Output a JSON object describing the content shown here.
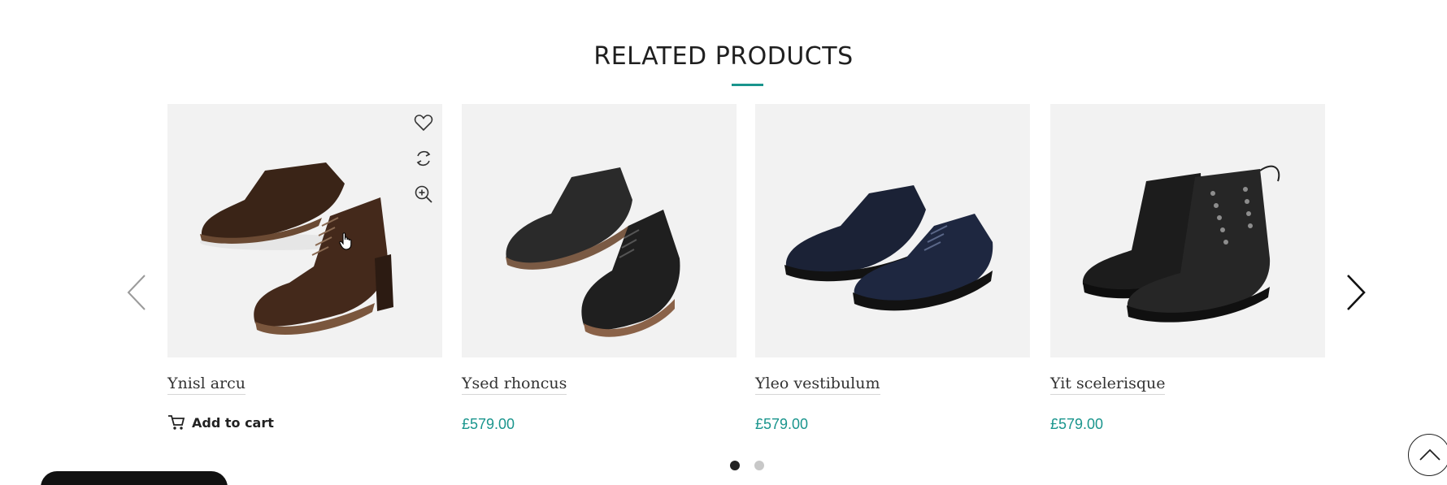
{
  "section": {
    "title": "RELATED PRODUCTS"
  },
  "colors": {
    "accent": "#1a958d",
    "text": "#222222",
    "image_bg": "#f2f2f2"
  },
  "carousel": {
    "prev_icon": "chevron-left-icon",
    "next_icon": "chevron-right-icon",
    "page_count": 2,
    "active_page": 1
  },
  "products": [
    {
      "name": "Ynisl arcu",
      "price": "£579.00",
      "action_label": "Add to cart",
      "hovered": true
    },
    {
      "name": "Ysed rhoncus",
      "price": "£579.00"
    },
    {
      "name": "Yleo vestibulum",
      "price": "£579.00"
    },
    {
      "name": "Yit scelerisque",
      "price": "£579.00"
    }
  ],
  "hover_icons": [
    "heart-icon",
    "compare-icon",
    "zoom-in-icon"
  ]
}
